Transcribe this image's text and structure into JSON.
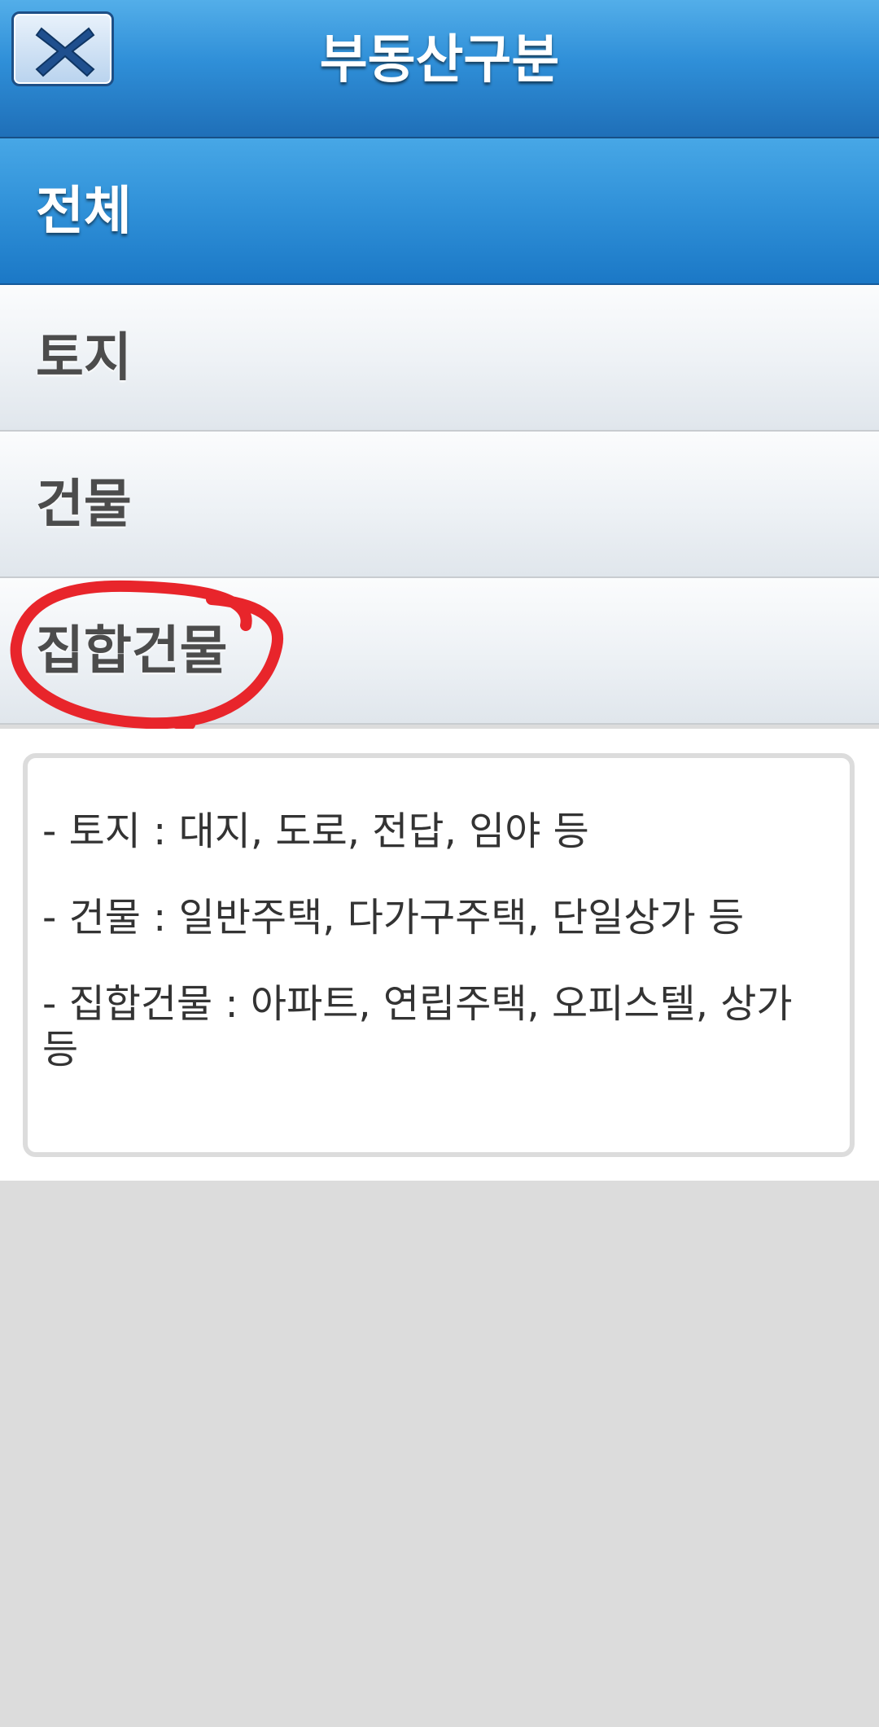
{
  "header": {
    "title": "부동산구분",
    "close_icon": "close-x-icon"
  },
  "list": {
    "items": [
      {
        "label": "전체",
        "active": true
      },
      {
        "label": "토지",
        "active": false
      },
      {
        "label": "건물",
        "active": false
      },
      {
        "label": "집합건물",
        "active": false
      }
    ]
  },
  "info": {
    "lines": [
      "- 토지 : 대지, 도로, 전답, 임야 등",
      "- 건물 : 일반주택, 다가구주택, 단일상가 등",
      "- 집합건물 : 아파트, 연립주택, 오피스텔, 상가 등"
    ]
  },
  "colors": {
    "header_blue": "#2f8fd8",
    "active_blue": "#1b78c6",
    "annotation_red": "#e8252b",
    "background_gray": "#dcdcdc"
  }
}
